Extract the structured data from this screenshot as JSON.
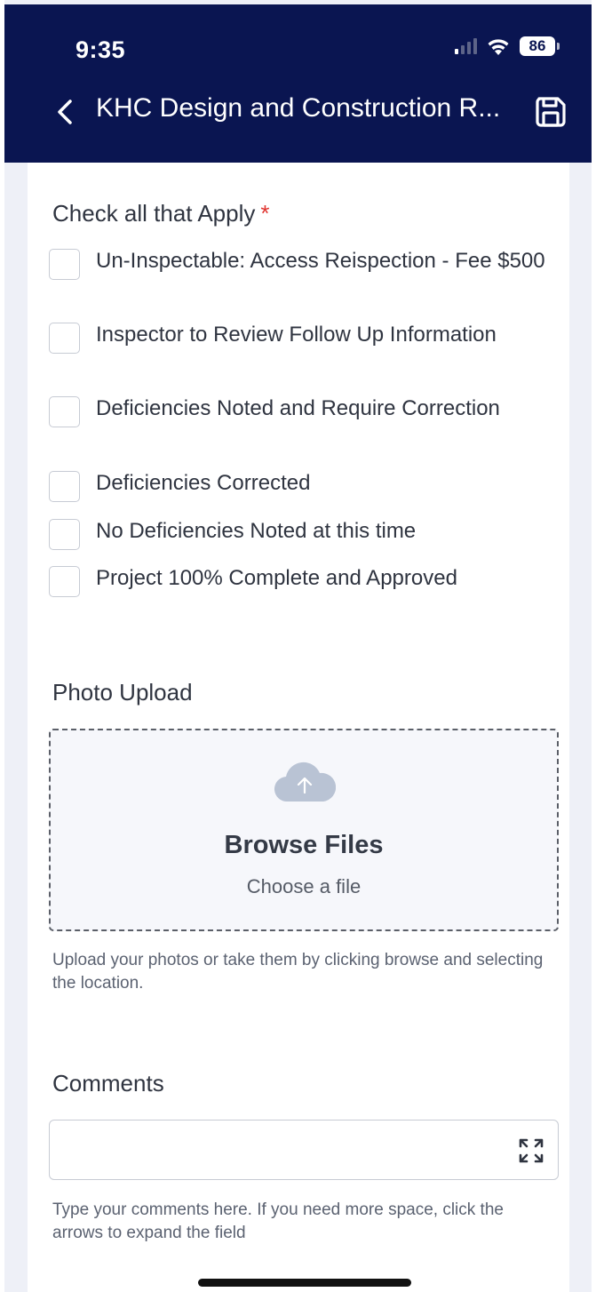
{
  "status_bar": {
    "time": "9:35",
    "battery": "86"
  },
  "nav": {
    "title": "KHC Design and Construction R..."
  },
  "checklist": {
    "label": "Check all that Apply",
    "required_mark": "*",
    "items": [
      {
        "label": "Un-Inspectable: Access Reispection - Fee $500",
        "checked": false
      },
      {
        "label": "Inspector to Review Follow Up Information",
        "checked": false
      },
      {
        "label": "Deficiencies Noted and Require Correction",
        "checked": false
      },
      {
        "label": "Deficiencies Corrected",
        "checked": false
      },
      {
        "label": "No Deficiencies Noted at this time",
        "checked": false
      },
      {
        "label": "Project 100% Complete and Approved",
        "checked": false
      }
    ]
  },
  "photo_upload": {
    "label": "Photo Upload",
    "browse_title": "Browse Files",
    "choose_text": "Choose a file",
    "helper": "Upload your photos or take them by clicking browse and selecting the location."
  },
  "comments": {
    "label": "Comments",
    "value": "",
    "helper": "Type your comments here. If you need more space, click the arrows to expand the field"
  },
  "colors": {
    "header_bg": "#0a1551",
    "required": "#e0342f",
    "page_bg": "#eef0f7"
  }
}
